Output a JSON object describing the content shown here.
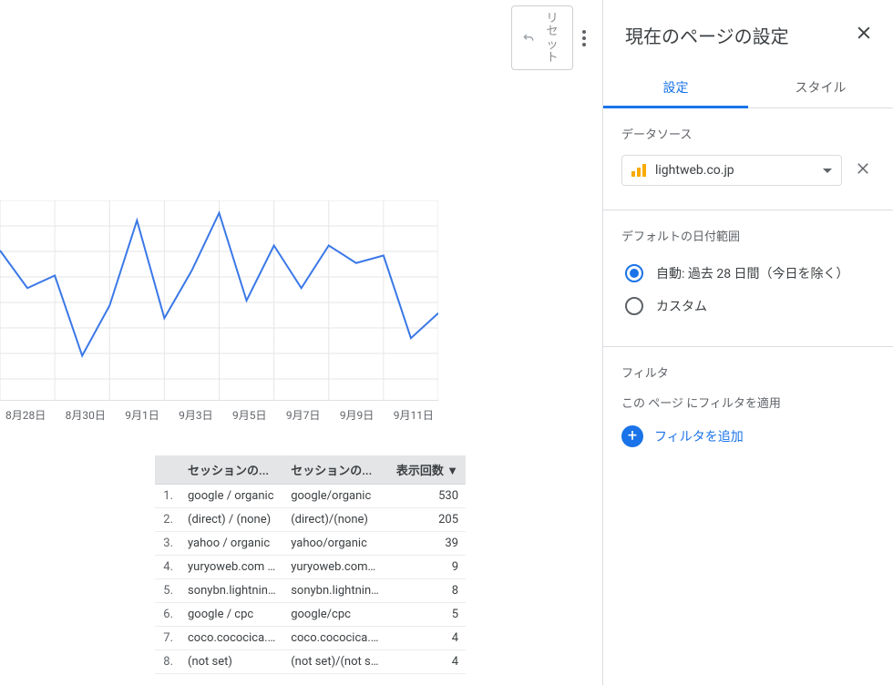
{
  "toolbar": {
    "reset_label": "リセット"
  },
  "chart_data": {
    "type": "line",
    "categories": [
      "8月28日",
      "8月30日",
      "9月1日",
      "9月3日",
      "9月5日",
      "9月7日",
      "9月9日",
      "9月11日"
    ],
    "series": [
      {
        "name": "",
        "values": [
          60,
          45,
          50,
          18,
          38,
          72,
          33,
          52,
          75,
          40,
          62,
          45,
          62,
          55,
          58,
          25,
          35
        ]
      }
    ],
    "ylim": [
      0,
      80
    ],
    "title": "",
    "xlabel": "",
    "ylabel": ""
  },
  "table": {
    "headers": [
      "セッションの...",
      "セッションの...",
      "表示回数"
    ],
    "rows": [
      {
        "n": "1.",
        "c1": "google / organic",
        "c2": "google/organic",
        "v": "530"
      },
      {
        "n": "2.",
        "c1": "(direct) / (none)",
        "c2": "(direct)/(none)",
        "v": "205"
      },
      {
        "n": "3.",
        "c1": "yahoo / organic",
        "c2": "yahoo/organic",
        "v": "39"
      },
      {
        "n": "4.",
        "c1": "yuryoweb.com / re...",
        "c2": "yuryoweb.com/ref...",
        "v": "9"
      },
      {
        "n": "5.",
        "c1": "sonybn.lightning.f...",
        "c2": "sonybn.lightning.f...",
        "v": "8"
      },
      {
        "n": "6.",
        "c1": "google / cpc",
        "c2": "google/cpc",
        "v": "5"
      },
      {
        "n": "7.",
        "c1": "coco.cococica.co...",
        "c2": "coco.cococica.co...",
        "v": "4"
      },
      {
        "n": "8.",
        "c1": "(not set)",
        "c2": "(not set)/(not set)",
        "v": "4"
      }
    ]
  },
  "panel": {
    "title": "現在のページの設定",
    "tabs": {
      "settings": "設定",
      "style": "スタイル"
    },
    "data_source": {
      "label": "データソース",
      "name": "lightweb.co.jp"
    },
    "date_range": {
      "label": "デフォルトの日付範囲",
      "auto_prefix": "自動",
      "auto_suffix": ": 過去 28 日間（今日を除く）",
      "custom": "カスタム"
    },
    "filter": {
      "label": "フィルタ",
      "desc": "この ページ にフィルタを適用",
      "add": "フィルタを追加"
    }
  }
}
